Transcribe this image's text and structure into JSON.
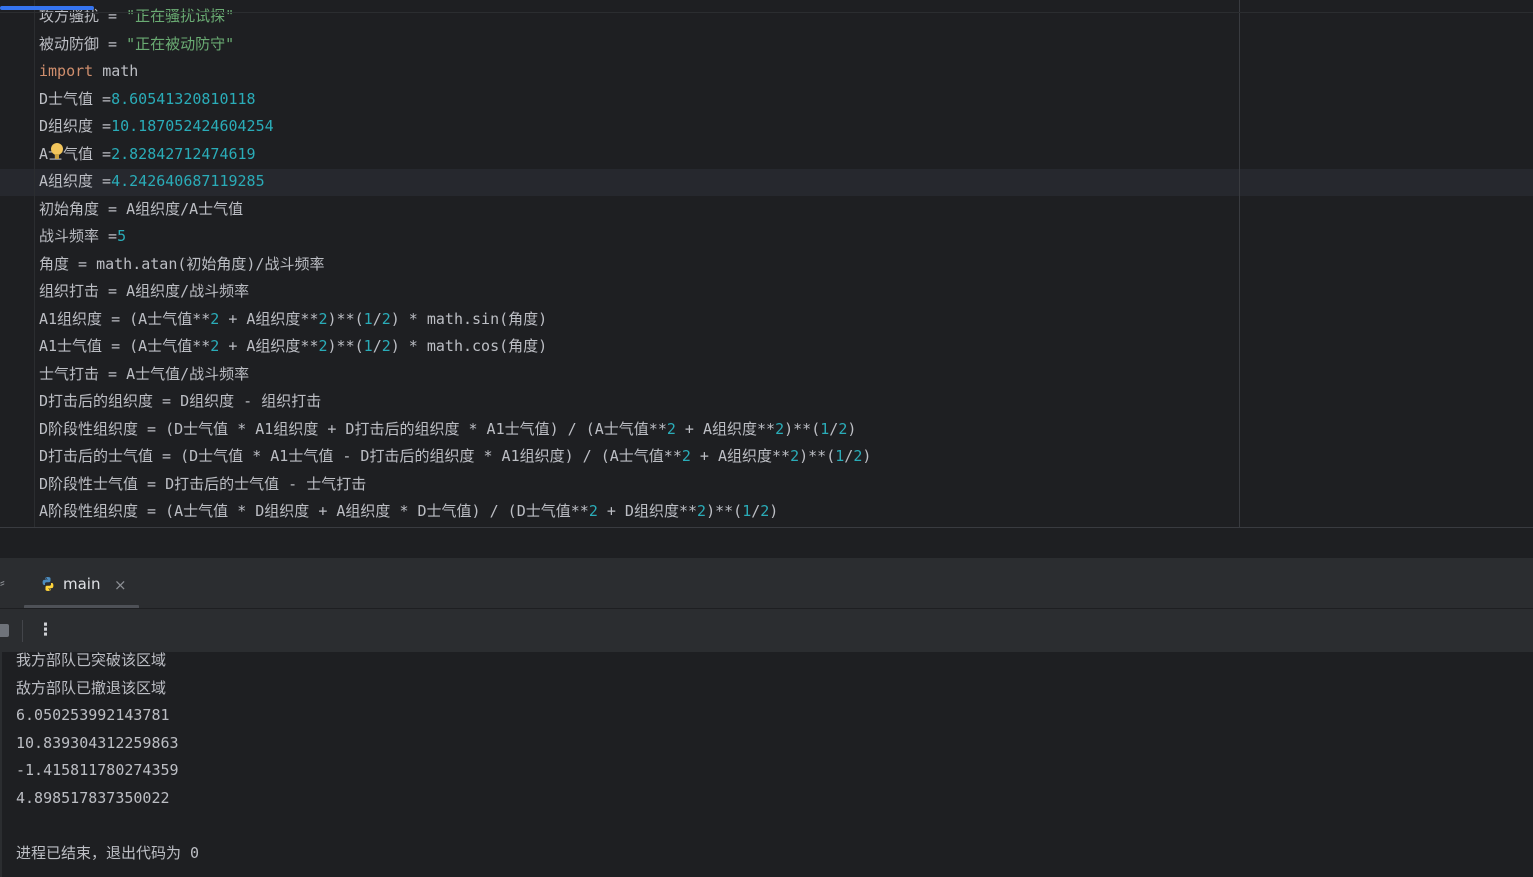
{
  "editor": {
    "lines": [
      [
        {
          "t": "攻方骚扰 = ",
          "c": ""
        },
        {
          "t": "\"正在骚扰试探\"",
          "c": "str"
        }
      ],
      [
        {
          "t": "被动防御 = ",
          "c": ""
        },
        {
          "t": "\"正在被动防守\"",
          "c": "str"
        }
      ],
      [
        {
          "t": "import",
          "c": "kw"
        },
        {
          "t": " math",
          "c": ""
        }
      ],
      [
        {
          "t": "D士气值 =",
          "c": ""
        },
        {
          "t": "8.60541320810118",
          "c": "num"
        }
      ],
      [
        {
          "t": "D组织度 =",
          "c": ""
        },
        {
          "t": "10.187052424604254",
          "c": "num"
        }
      ],
      [
        {
          "t": "A士气值 =",
          "c": ""
        },
        {
          "t": "2.82842712474619",
          "c": "num"
        }
      ],
      [
        {
          "t": "A组织度 =",
          "c": ""
        },
        {
          "t": "4.242640687119285",
          "c": "num"
        }
      ],
      [
        {
          "t": "初始角度 = A组织度/A士气值",
          "c": ""
        }
      ],
      [
        {
          "t": "战斗频率 =",
          "c": ""
        },
        {
          "t": "5",
          "c": "num"
        }
      ],
      [
        {
          "t": "角度 = math.atan(初始角度)/战斗频率",
          "c": ""
        }
      ],
      [
        {
          "t": "组织打击 = A组织度/战斗频率",
          "c": ""
        }
      ],
      [
        {
          "t": "A1组织度 = (A士气值**",
          "c": ""
        },
        {
          "t": "2",
          "c": "num"
        },
        {
          "t": " + A组织度**",
          "c": ""
        },
        {
          "t": "2",
          "c": "num"
        },
        {
          "t": ")**(",
          "c": ""
        },
        {
          "t": "1",
          "c": "num"
        },
        {
          "t": "/",
          "c": ""
        },
        {
          "t": "2",
          "c": "num"
        },
        {
          "t": ") * math.sin(角度)",
          "c": ""
        }
      ],
      [
        {
          "t": "A1士气值 = (A士气值**",
          "c": ""
        },
        {
          "t": "2",
          "c": "num"
        },
        {
          "t": " + A组织度**",
          "c": ""
        },
        {
          "t": "2",
          "c": "num"
        },
        {
          "t": ")**(",
          "c": ""
        },
        {
          "t": "1",
          "c": "num"
        },
        {
          "t": "/",
          "c": ""
        },
        {
          "t": "2",
          "c": "num"
        },
        {
          "t": ") * math.cos(角度)",
          "c": ""
        }
      ],
      [
        {
          "t": "士气打击 = A士气值/战斗频率",
          "c": ""
        }
      ],
      [
        {
          "t": "D打击后的组织度 = D组织度 - 组织打击",
          "c": ""
        }
      ],
      [
        {
          "t": "D阶段性组织度 = (D士气值 * A1组织度 + D打击后的组织度 * A1士气值) / (A士气值**",
          "c": ""
        },
        {
          "t": "2",
          "c": "num"
        },
        {
          "t": " + A组织度**",
          "c": ""
        },
        {
          "t": "2",
          "c": "num"
        },
        {
          "t": ")**(",
          "c": ""
        },
        {
          "t": "1",
          "c": "num"
        },
        {
          "t": "/",
          "c": ""
        },
        {
          "t": "2",
          "c": "num"
        },
        {
          "t": ")",
          "c": ""
        }
      ],
      [
        {
          "t": "D打击后的士气值 = (D士气值 * A1士气值 - D打击后的组织度 * A1组织度) / (A士气值**",
          "c": ""
        },
        {
          "t": "2",
          "c": "num"
        },
        {
          "t": " + A组织度**",
          "c": ""
        },
        {
          "t": "2",
          "c": "num"
        },
        {
          "t": ")**(",
          "c": ""
        },
        {
          "t": "1",
          "c": "num"
        },
        {
          "t": "/",
          "c": ""
        },
        {
          "t": "2",
          "c": "num"
        },
        {
          "t": ")",
          "c": ""
        }
      ],
      [
        {
          "t": "D阶段性士气值 = D打击后的士气值 - 士气打击",
          "c": ""
        }
      ],
      [
        {
          "t": "A阶段性组织度 = (A士气值 * D组织度 + A组织度 * D士气值) / (D士气值**",
          "c": ""
        },
        {
          "t": "2",
          "c": "num"
        },
        {
          "t": " + D组织度**",
          "c": ""
        },
        {
          "t": "2",
          "c": "num"
        },
        {
          "t": ")**(",
          "c": ""
        },
        {
          "t": "1",
          "c": "num"
        },
        {
          "t": "/",
          "c": ""
        },
        {
          "t": "2",
          "c": "num"
        },
        {
          "t": ")",
          "c": ""
        }
      ]
    ]
  },
  "run_panel": {
    "tab_label": "main",
    "tab_close": "×",
    "left_edge_glyph": "⸗",
    "more_label": "⋮",
    "icons": {
      "tab": "python-icon",
      "close": "close-icon",
      "stop": "stop-icon",
      "more": "more-vertical-icon",
      "hint": "lightbulb-icon"
    },
    "colors": {
      "python_blue": "#4b8bbe",
      "python_yellow": "#ffd43b",
      "bulb": "#f2c55c"
    }
  },
  "console": {
    "lines": [
      "我方部队已突破该区域",
      "敌方部队已撤退该区域",
      "6.050253992143781",
      "10.839304312259863",
      "-1.415811780274359",
      "4.898517837350022",
      "",
      "进程已结束，退出代码为 0"
    ]
  }
}
